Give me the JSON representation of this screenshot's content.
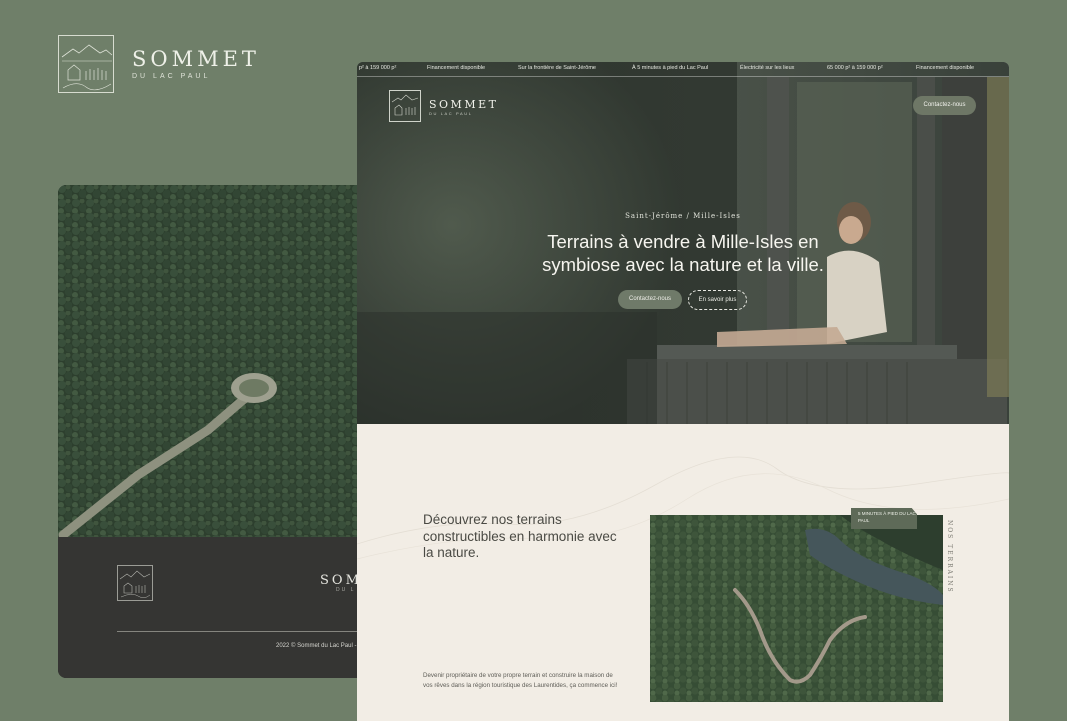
{
  "brand": {
    "name": "SOMMET",
    "subtitle": "DU LAC PAUL"
  },
  "back_card": {
    "footer_brand": "SOMM",
    "footer_brand_sub": "DU L",
    "copyright": "2022 © Sommet du Lac Paul - D"
  },
  "ticker": [
    "p² à 159 000 p²",
    "Financement disponible",
    "Sur la frontière de Saint-Jérôme",
    "À 5 minutes à pied du Lac Paul",
    "Électricité sur les lieux",
    "65 000 p² à 159 000 p²",
    "Financement disponible"
  ],
  "header": {
    "brand_name": "SOMMET",
    "brand_sub": "DU LAC PAUL",
    "contact_label": "Contactez-nous"
  },
  "hero": {
    "kicker": "Saint-Jérôme / Mille-Isles",
    "title": "Terrains à vendre à Mille-Isles en symbiose avec la nature et la ville.",
    "contact_label": "Contactez-nous",
    "more_label": "En savoir plus"
  },
  "intro": {
    "title": "Découvrez nos terrains constructibles en harmonie avec la nature.",
    "body": "Devenir propriétaire de votre propre terrain et construire la maison de vos rêves dans la région touristique des Laurentides, ça commence ici!",
    "badge": "5 MINUTES À PIED DU LAC PAUL",
    "side_label": "NOS TERRAINS"
  },
  "colors": {
    "background": "#6f7f69",
    "accent": "#6e7766",
    "cream": "#f2ede5",
    "dark": "#353533"
  }
}
